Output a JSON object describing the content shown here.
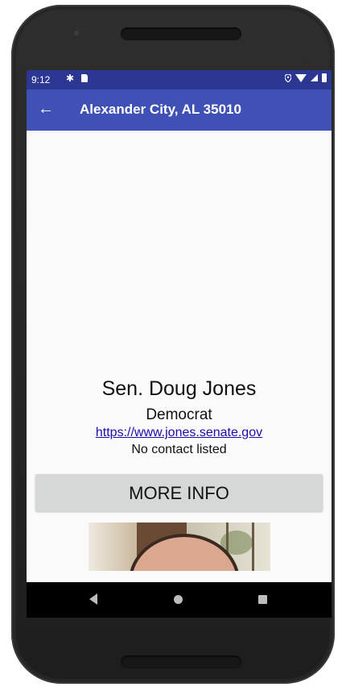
{
  "status_bar": {
    "time": "9:12",
    "icons": [
      "gear-icon",
      "sd-card-icon",
      "location-icon",
      "wifi-icon",
      "signal-icon",
      "battery-icon"
    ]
  },
  "app_bar": {
    "back_icon": "arrow-back-icon",
    "title": "Alexander City, AL 35010",
    "color": "#3f51b5"
  },
  "representative": {
    "name": "Sen. Doug Jones",
    "party": "Democrat",
    "website": "https://www.jones.senate.gov",
    "contact": "No contact listed",
    "photo": "portrait-photo"
  },
  "more_info_button": {
    "label": "MORE INFO"
  },
  "nav_bar": {
    "icons": [
      "nav-back-icon",
      "nav-home-icon",
      "nav-recents-icon"
    ]
  }
}
